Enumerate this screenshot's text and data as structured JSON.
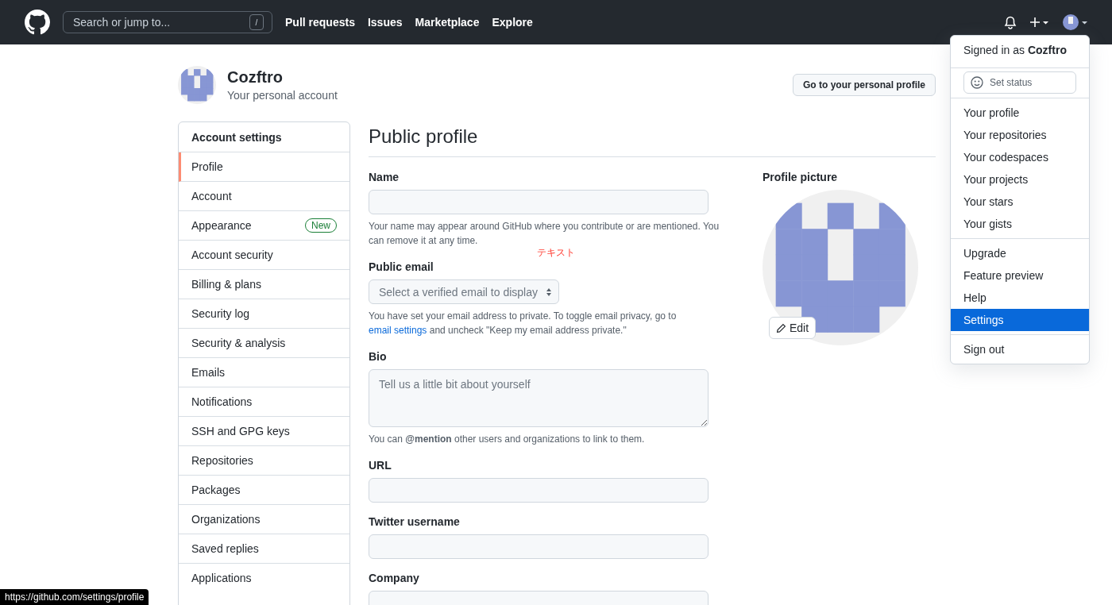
{
  "header": {
    "search": {
      "placeholder": "Search or jump to...",
      "key": "/"
    },
    "nav": [
      "Pull requests",
      "Issues",
      "Marketplace",
      "Explore"
    ]
  },
  "account": {
    "name": "Cozftro",
    "subtitle": "Your personal account",
    "profile_button": "Go to your personal profile"
  },
  "sidebar": {
    "heading": "Account settings",
    "items": [
      {
        "label": "Profile",
        "selected": true
      },
      {
        "label": "Account",
        "selected": false
      },
      {
        "label": "Appearance",
        "selected": false,
        "badge": "New"
      },
      {
        "label": "Account security",
        "selected": false
      },
      {
        "label": "Billing & plans",
        "selected": false
      },
      {
        "label": "Security log",
        "selected": false
      },
      {
        "label": "Security & analysis",
        "selected": false
      },
      {
        "label": "Emails",
        "selected": false
      },
      {
        "label": "Notifications",
        "selected": false
      },
      {
        "label": "SSH and GPG keys",
        "selected": false
      },
      {
        "label": "Repositories",
        "selected": false
      },
      {
        "label": "Packages",
        "selected": false
      },
      {
        "label": "Organizations",
        "selected": false
      },
      {
        "label": "Saved replies",
        "selected": false
      },
      {
        "label": "Applications",
        "selected": false
      }
    ]
  },
  "main": {
    "title": "Public profile",
    "fields": [
      {
        "kind": "text",
        "label": "Name",
        "note": "Your name may appear around GitHub where you contribute or are mentioned. You can remove it at any time."
      },
      {
        "kind": "select",
        "label": "Public email",
        "placeholder": "Select a verified email to display",
        "note": "You have set your email address to private. To toggle email privacy, go to",
        "link": "email settings",
        "note_after": "and uncheck \"Keep my email address private.\""
      },
      {
        "kind": "textarea",
        "label": "Bio",
        "placeholder": "Tell us a little bit about yourself",
        "note": "You can **@mention** other users and organizations to link to them."
      },
      {
        "kind": "text",
        "label": "URL"
      },
      {
        "kind": "text",
        "label": "Twitter username"
      },
      {
        "kind": "text",
        "label": "Company"
      }
    ],
    "annotation": "テキスト"
  },
  "profile_picture": {
    "label": "Profile picture",
    "edit": "Edit"
  },
  "menu": {
    "signed_in": "Signed in as **Cozftro**",
    "set_status": "Set status",
    "groups": [
      [
        {
          "label": "Your profile",
          "selected": false
        },
        {
          "label": "Your repositories",
          "selected": false
        },
        {
          "label": "Your codespaces",
          "selected": false
        },
        {
          "label": "Your projects",
          "selected": false
        },
        {
          "label": "Your stars",
          "selected": false
        },
        {
          "label": "Your gists",
          "selected": false
        }
      ],
      [
        {
          "label": "Upgrade",
          "selected": false
        },
        {
          "label": "Feature preview",
          "selected": false
        },
        {
          "label": "Help",
          "selected": false
        },
        {
          "label": "Settings",
          "selected": true
        }
      ],
      [
        {
          "label": "Sign out",
          "selected": false
        }
      ]
    ]
  },
  "status_url": "https://github.com/settings/profile"
}
